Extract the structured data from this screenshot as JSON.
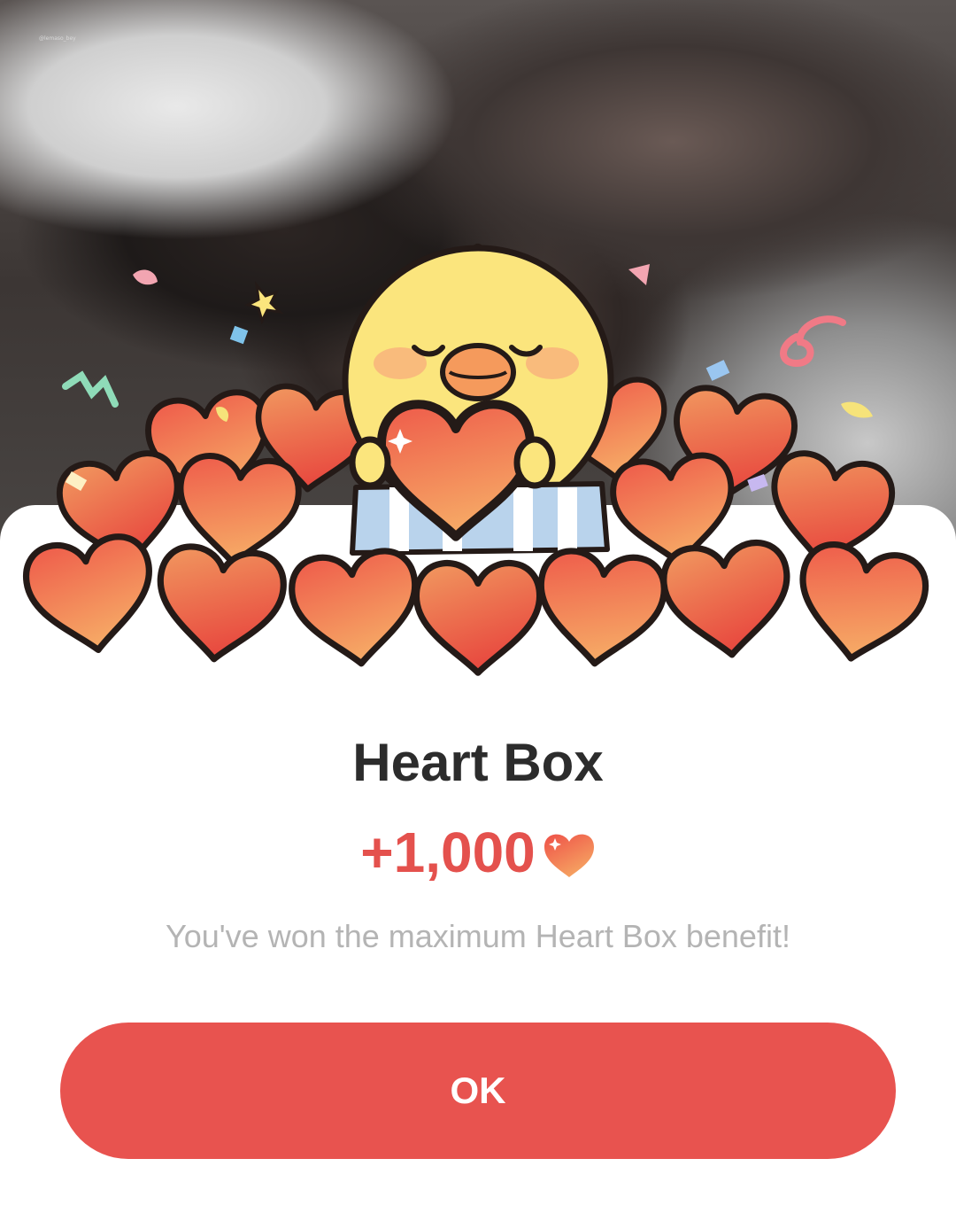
{
  "watermark": "@lemaso_bey",
  "dialog": {
    "title": "Heart Box",
    "reward_amount": "+1,000",
    "reward_icon": "heart-icon",
    "message": "You've won the maximum Heart Box benefit!",
    "ok_label": "OK"
  },
  "illustration": {
    "character": "yellow-chick",
    "theme": "pile-of-hearts-with-confetti"
  },
  "colors": {
    "accent": "#e8534f",
    "reward_text": "#e4514d",
    "title_text": "#2c2c2c",
    "message_text": "#b4b4b4",
    "heart_light": "#f59a5c",
    "heart_dark": "#ec4f45",
    "chick": "#fbe57d"
  }
}
